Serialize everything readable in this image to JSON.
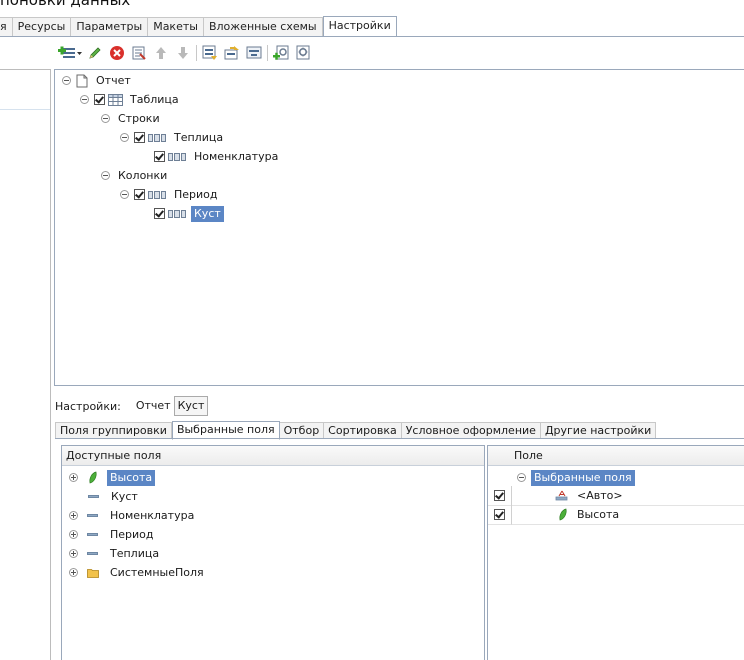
{
  "window": {
    "title_fragment": "поновки данных"
  },
  "tabs": [
    {
      "label": "я"
    },
    {
      "label": "Ресурсы"
    },
    {
      "label": "Параметры"
    },
    {
      "label": "Макеты"
    },
    {
      "label": "Вложенные схемы"
    },
    {
      "label": "Настройки"
    }
  ],
  "active_tab": "Настройки",
  "toolbar": {
    "icons": [
      "add-dropdown-icon",
      "edit-icon",
      "delete-icon",
      "properties-icon",
      "move-up-icon",
      "move-down-icon",
      "group-icon",
      "move-out-icon",
      "group-fields-icon",
      "add-settings-icon",
      "settings-icon"
    ]
  },
  "tree": {
    "root": "Отчет",
    "table": "Таблица",
    "rows_label": "Строки",
    "row_group": "Теплица",
    "row_child": "Номенклатура",
    "cols_label": "Колонки",
    "col_group": "Период",
    "col_child": "Куст"
  },
  "settings": {
    "label": "Настройки:",
    "report": "Отчет",
    "current": "Куст"
  },
  "subtabs": [
    {
      "label": "Поля группировки"
    },
    {
      "label": "Выбранные поля"
    },
    {
      "label": "Отбор"
    },
    {
      "label": "Сортировка"
    },
    {
      "label": "Условное оформление"
    },
    {
      "label": "Другие настройки"
    }
  ],
  "available_fields": {
    "header": "Доступные поля",
    "items": [
      {
        "label": "Высота",
        "expandable": true,
        "selected": true
      },
      {
        "label": "Куст",
        "expandable": false
      },
      {
        "label": "Номенклатура",
        "expandable": true
      },
      {
        "label": "Период",
        "expandable": true
      },
      {
        "label": "Теплица",
        "expandable": true
      },
      {
        "label": "СистемныеПоля",
        "expandable": true
      }
    ]
  },
  "selected_fields": {
    "header": "Поле",
    "group": "Выбранные поля",
    "items": [
      {
        "label": "<Авто>",
        "checked": true
      },
      {
        "label": "Высота",
        "checked": true
      }
    ]
  },
  "colors": {
    "selection": "#5b86c5",
    "border": "#9aa8bb",
    "accent_green": "#4caf3a",
    "delete_red": "#d9302b"
  }
}
